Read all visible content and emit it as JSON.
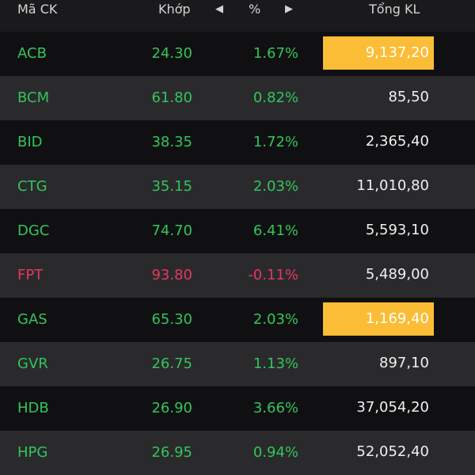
{
  "header": {
    "code_label": "Mã CK",
    "price_label": "Khớp",
    "prev_arrow": "◀",
    "pct_label": "%",
    "next_arrow": "▶",
    "volume_label": "Tổng KL"
  },
  "colors": {
    "up": "#33c45b",
    "down": "#e8365f",
    "highlight": "#fbbd36"
  },
  "rows": [
    {
      "code": "ACB",
      "price": "24.30",
      "pct": "1.67%",
      "volume": "9,137,20",
      "trend": "up",
      "highlight": true
    },
    {
      "code": "BCM",
      "price": "61.80",
      "pct": "0.82%",
      "volume": "85,50",
      "trend": "up",
      "highlight": false
    },
    {
      "code": "BID",
      "price": "38.35",
      "pct": "1.72%",
      "volume": "2,365,40",
      "trend": "up",
      "highlight": false
    },
    {
      "code": "CTG",
      "price": "35.15",
      "pct": "2.03%",
      "volume": "11,010,80",
      "trend": "up",
      "highlight": false
    },
    {
      "code": "DGC",
      "price": "74.70",
      "pct": "6.41%",
      "volume": "5,593,10",
      "trend": "up",
      "highlight": false
    },
    {
      "code": "FPT",
      "price": "93.80",
      "pct": "-0.11%",
      "volume": "5,489,00",
      "trend": "down",
      "highlight": false
    },
    {
      "code": "GAS",
      "price": "65.30",
      "pct": "2.03%",
      "volume": "1,169,40",
      "trend": "up",
      "highlight": true
    },
    {
      "code": "GVR",
      "price": "26.75",
      "pct": "1.13%",
      "volume": "897,10",
      "trend": "up",
      "highlight": false
    },
    {
      "code": "HDB",
      "price": "26.90",
      "pct": "3.66%",
      "volume": "37,054,20",
      "trend": "up",
      "highlight": false
    },
    {
      "code": "HPG",
      "price": "26.95",
      "pct": "0.94%",
      "volume": "52,052,40",
      "trend": "up",
      "highlight": false
    }
  ]
}
